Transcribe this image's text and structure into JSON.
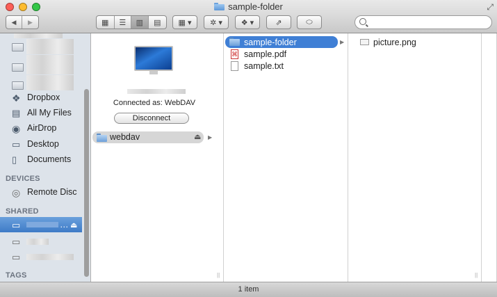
{
  "window": {
    "title": "sample-folder"
  },
  "toolbar": {
    "back": "◀",
    "forward": "▶"
  },
  "search": {
    "placeholder": ""
  },
  "sidebar": {
    "items": [
      {
        "label": "Dropbox"
      },
      {
        "label": "All My Files"
      },
      {
        "label": "AirDrop"
      },
      {
        "label": "Desktop"
      },
      {
        "label": "Documents"
      }
    ],
    "devices_header": "DEVICES",
    "devices": [
      {
        "label": "Remote Disc"
      }
    ],
    "shared_header": "SHARED",
    "shared_selected_label": "…",
    "tags_header": "TAGS"
  },
  "server_panel": {
    "connected_text": "Connected as: WebDAV",
    "disconnect_label": "Disconnect",
    "volume_label": "webdav"
  },
  "column2": {
    "items": [
      {
        "label": "sample-folder"
      },
      {
        "label": "sample.pdf"
      },
      {
        "label": "sample.txt"
      }
    ]
  },
  "column3": {
    "items": [
      {
        "label": "picture.png"
      }
    ]
  },
  "status_bar": {
    "text": "1 item"
  },
  "colors": {
    "selection": "#3f7fd5",
    "sidebar_selection": "#4f8ad0",
    "sidebar_bg": "#dde3ea"
  }
}
